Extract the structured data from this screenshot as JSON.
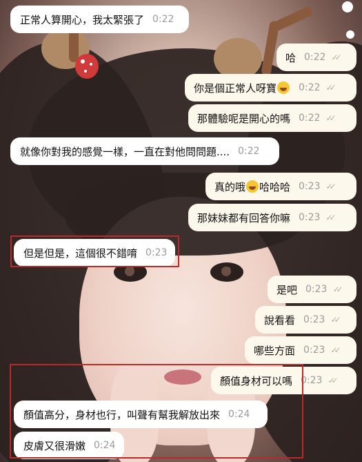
{
  "theme": {
    "incoming_bubble": "#ffffff",
    "outgoing_bubble": "#fdf8ec",
    "highlight_box": "#b92a2a",
    "tick_color": "#b5b0a3"
  },
  "messages": [
    {
      "text": "正常人算開心，我太緊張了",
      "time": "0:22",
      "direction": "incoming"
    },
    {
      "text": "哈",
      "time": "0:22",
      "direction": "outgoing",
      "status": "read-double-check"
    },
    {
      "text_before": "你是個正常人呀寶",
      "emoji": "face-with-tears-of-joy",
      "text_after": "",
      "time": "0:22",
      "direction": "outgoing",
      "status": "read-double-check"
    },
    {
      "text": "那體驗呢是開心的嗎",
      "time": "0:22",
      "direction": "outgoing",
      "status": "read-double-check"
    },
    {
      "text": "就像你對我的感覺一樣，一直在對他問問題....",
      "time": "0:22",
      "direction": "incoming"
    },
    {
      "text_before": "真的哦",
      "emoji": "face-with-tears-of-joy",
      "text_after": "哈哈哈",
      "time": "0:23",
      "direction": "outgoing",
      "status": "read-double-check"
    },
    {
      "text": "那妹妹都有回答你嘛",
      "time": "0:23",
      "direction": "outgoing",
      "status": "read-double-check"
    },
    {
      "text": "但是但是，這個很不錯唷",
      "time": "0:23",
      "direction": "incoming"
    },
    {
      "text": "是吧",
      "time": "0:23",
      "direction": "outgoing",
      "status": "read-double-check"
    },
    {
      "text": "說看看",
      "time": "0:23",
      "direction": "outgoing",
      "status": "read-double-check"
    },
    {
      "text": "哪些方面",
      "time": "0:23",
      "direction": "outgoing",
      "status": "read-double-check"
    },
    {
      "text": "顏值身材可以嗎",
      "time": "0:23",
      "direction": "outgoing",
      "status": "read-double-check"
    },
    {
      "text": "顏值高分，身材也行，叫聲有幫我解放出來",
      "time": "0:24",
      "direction": "incoming"
    },
    {
      "text": "皮膚又很滑嫩",
      "time": "0:24",
      "direction": "incoming"
    }
  ],
  "ticks_glyph": "✓✓",
  "background": "chat-wallpaper-photo"
}
